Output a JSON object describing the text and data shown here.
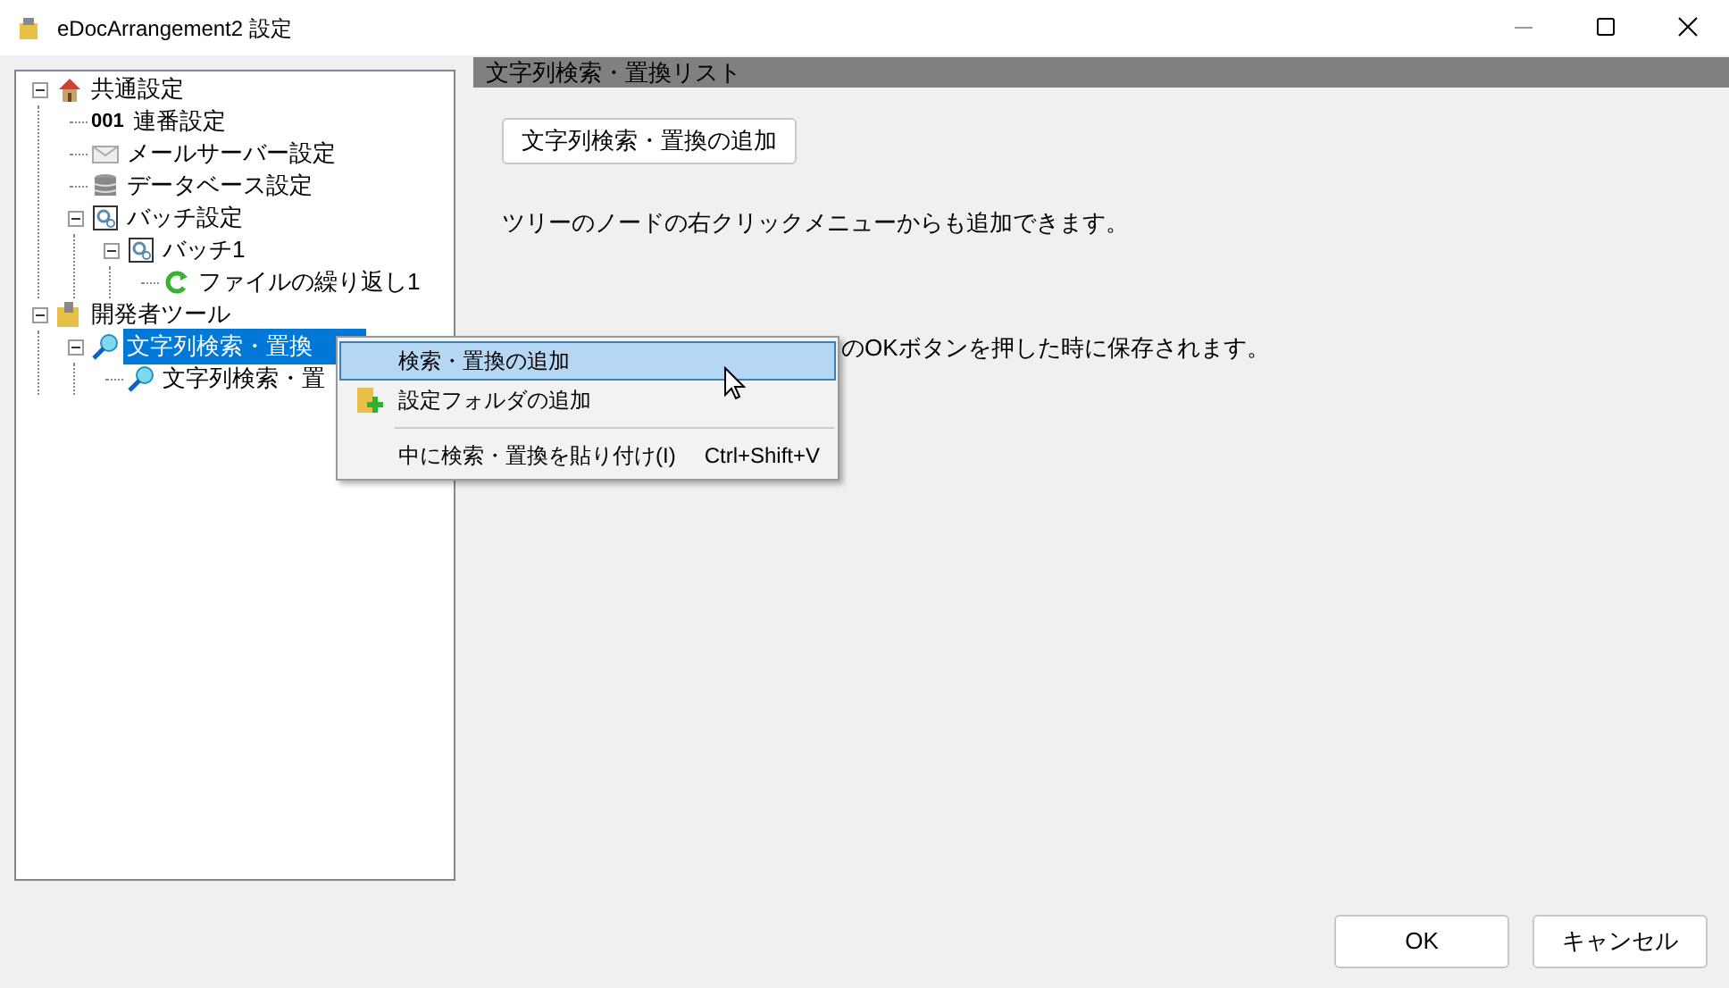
{
  "window": {
    "title": "eDocArrangement2 設定"
  },
  "tree": [
    {
      "label": "共通設定",
      "kind": "house",
      "expanded": true,
      "selected": false,
      "children": [
        {
          "label": "連番設定",
          "kind": "number",
          "badge": "001",
          "selected": false
        },
        {
          "label": "メールサーバー設定",
          "kind": "mail",
          "selected": false
        },
        {
          "label": "データベース設定",
          "kind": "database",
          "selected": false
        },
        {
          "label": "バッチ設定",
          "kind": "batch",
          "expanded": true,
          "selected": false,
          "children": [
            {
              "label": "バッチ1",
              "kind": "batch",
              "expanded": true,
              "selected": false,
              "children": [
                {
                  "label": "ファイルの繰り返し1",
                  "kind": "loop",
                  "selected": false
                }
              ]
            }
          ]
        }
      ]
    },
    {
      "label": "開発者ツール",
      "kind": "folder",
      "expanded": true,
      "selected": false,
      "children": [
        {
          "label": "文字列検索・置換",
          "kind": "search",
          "expanded": true,
          "selected": true,
          "children": [
            {
              "label": "文字列検索・置",
              "kind": "search",
              "selected": false
            }
          ]
        }
      ]
    }
  ],
  "panel": {
    "header": "文字列検索・置換リスト",
    "add_button": "文字列検索・置換の追加",
    "notes": [
      "ツリーのノードの右クリックメニューからも追加できます。",
      "のOKボタンを押した時に保存されます。"
    ]
  },
  "context_menu": [
    {
      "kind": "item",
      "label": "検索・置換の追加",
      "selected": true
    },
    {
      "kind": "icon_item",
      "label": "設定フォルダの追加",
      "selected": false
    },
    {
      "kind": "separator"
    },
    {
      "kind": "item",
      "label": "中に検索・置換を貼り付け(I)",
      "shortcut": "Ctrl+Shift+V",
      "selected": false
    }
  ],
  "buttons": [
    "OK",
    "キャンセル"
  ]
}
